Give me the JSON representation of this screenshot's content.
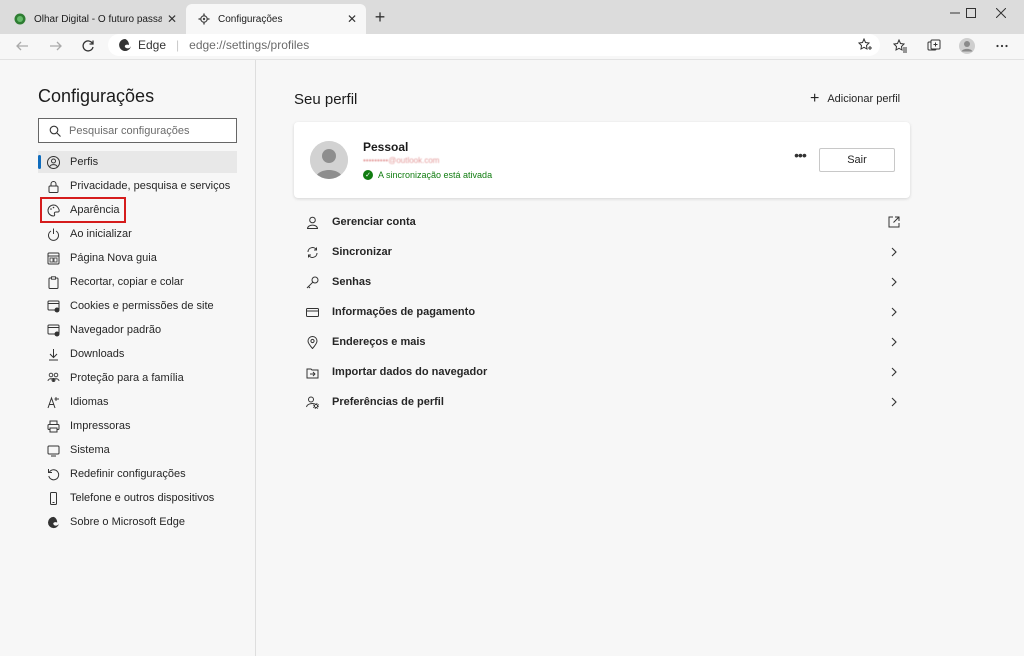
{
  "tabs": [
    {
      "title": "Olhar Digital - O futuro passa p…",
      "close": "✕",
      "icon": "olhar-digital-favicon"
    },
    {
      "title": "Configurações",
      "close": "✕",
      "icon": "gear-icon"
    }
  ],
  "new_tab": "+",
  "window_controls": {
    "minimize": "—",
    "maximize": "☐",
    "close": "✕"
  },
  "address": {
    "brand": "Edge",
    "separator": "|",
    "url": "edge://settings/profiles"
  },
  "sidebar": {
    "title": "Configurações",
    "search_placeholder": "Pesquisar configurações",
    "items": [
      {
        "label": "Perfis",
        "icon": "profile-icon",
        "selected": true
      },
      {
        "label": "Privacidade, pesquisa e serviços",
        "icon": "lock-icon"
      },
      {
        "label": "Aparência",
        "icon": "palette-icon"
      },
      {
        "label": "Ao inicializar",
        "icon": "power-icon"
      },
      {
        "label": "Página Nova guia",
        "icon": "new-tab-page-icon"
      },
      {
        "label": "Recortar, copiar e colar",
        "icon": "clipboard-icon"
      },
      {
        "label": "Cookies e permissões de site",
        "icon": "site-permissions-icon"
      },
      {
        "label": "Navegador padrão",
        "icon": "default-browser-icon"
      },
      {
        "label": "Downloads",
        "icon": "download-icon"
      },
      {
        "label": "Proteção para a família",
        "icon": "family-icon"
      },
      {
        "label": "Idiomas",
        "icon": "language-icon"
      },
      {
        "label": "Impressoras",
        "icon": "printer-icon"
      },
      {
        "label": "Sistema",
        "icon": "system-icon"
      },
      {
        "label": "Redefinir configurações",
        "icon": "reset-icon"
      },
      {
        "label": "Telefone e outros dispositivos",
        "icon": "phone-icon"
      },
      {
        "label": "Sobre o Microsoft Edge",
        "icon": "edge-logo-icon"
      }
    ]
  },
  "main": {
    "title": "Seu perfil",
    "add_profile": "Adicionar perfil",
    "profile": {
      "name": "Pessoal",
      "email": "•••••••••@outlook.com",
      "sync_status": "A sincronização está ativada",
      "more": "•••",
      "sign_out": "Sair"
    },
    "rows": [
      {
        "label": "Gerenciar conta",
        "icon": "person-icon",
        "action": "external"
      },
      {
        "label": "Sincronizar",
        "icon": "sync-icon",
        "action": "chevron"
      },
      {
        "label": "Senhas",
        "icon": "key-icon",
        "action": "chevron"
      },
      {
        "label": "Informações de pagamento",
        "icon": "card-icon",
        "action": "chevron"
      },
      {
        "label": "Endereços e mais",
        "icon": "location-icon",
        "action": "chevron"
      },
      {
        "label": "Importar dados do navegador",
        "icon": "import-icon",
        "action": "chevron"
      },
      {
        "label": "Preferências de perfil",
        "icon": "profile-settings-icon",
        "action": "chevron"
      }
    ]
  },
  "colors": {
    "accent": "#0f6cbd",
    "sync_green": "#107c10",
    "highlight_red": "#d51c1c"
  }
}
